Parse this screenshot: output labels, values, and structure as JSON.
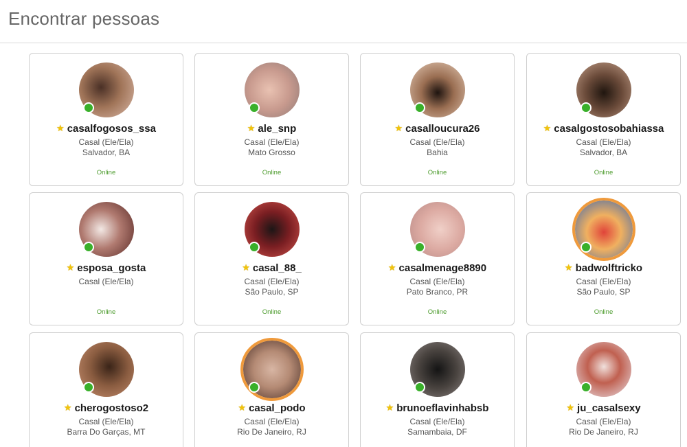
{
  "header": {
    "title": "Encontrar pessoas"
  },
  "colors": {
    "online_dot": "#39b02a",
    "online_text": "#4a9a2a",
    "star": "#f2c40a",
    "highlight_ring": "#ef9a3c"
  },
  "icons": {
    "star": "star-icon",
    "status": "online-dot-icon"
  },
  "profiles": [
    {
      "username": "casalfogosos_ssa",
      "gender": "Casal (Ele/Ela)",
      "location": "Salvador, BA",
      "status": "Online",
      "highlighted": false
    },
    {
      "username": "ale_snp",
      "gender": "Casal (Ele/Ela)",
      "location": "Mato Grosso",
      "status": "Online",
      "highlighted": false
    },
    {
      "username": "casalloucura26",
      "gender": "Casal (Ele/Ela)",
      "location": "Bahia",
      "status": "Online",
      "highlighted": false
    },
    {
      "username": "casalgostosobahiassa",
      "gender": "Casal (Ele/Ela)",
      "location": "Salvador, BA",
      "status": "Online",
      "highlighted": false
    },
    {
      "username": "esposa_gosta",
      "gender": "Casal (Ele/Ela)",
      "location": "",
      "status": "Online",
      "highlighted": false
    },
    {
      "username": "casal_88_",
      "gender": "Casal (Ele/Ela)",
      "location": "São Paulo, SP",
      "status": "Online",
      "highlighted": false
    },
    {
      "username": "casalmenage8890",
      "gender": "Casal (Ele/Ela)",
      "location": "Pato Branco, PR",
      "status": "Online",
      "highlighted": false
    },
    {
      "username": "badwolftricko",
      "gender": "Casal (Ele/Ela)",
      "location": "São Paulo, SP",
      "status": "Online",
      "highlighted": true
    },
    {
      "username": "cherogostoso2",
      "gender": "Casal (Ele/Ela)",
      "location": "Barra Do Garças, MT",
      "status": "",
      "highlighted": false
    },
    {
      "username": "casal_podo",
      "gender": "Casal (Ele/Ela)",
      "location": "Rio De Janeiro, RJ",
      "status": "",
      "highlighted": true
    },
    {
      "username": "brunoeflavinhabsb",
      "gender": "Casal (Ele/Ela)",
      "location": "Samambaia, DF",
      "status": "",
      "highlighted": false
    },
    {
      "username": "ju_casalsexy",
      "gender": "Casal (Ele/Ela)",
      "location": "Rio De Janeiro, RJ",
      "status": "",
      "highlighted": false
    }
  ]
}
